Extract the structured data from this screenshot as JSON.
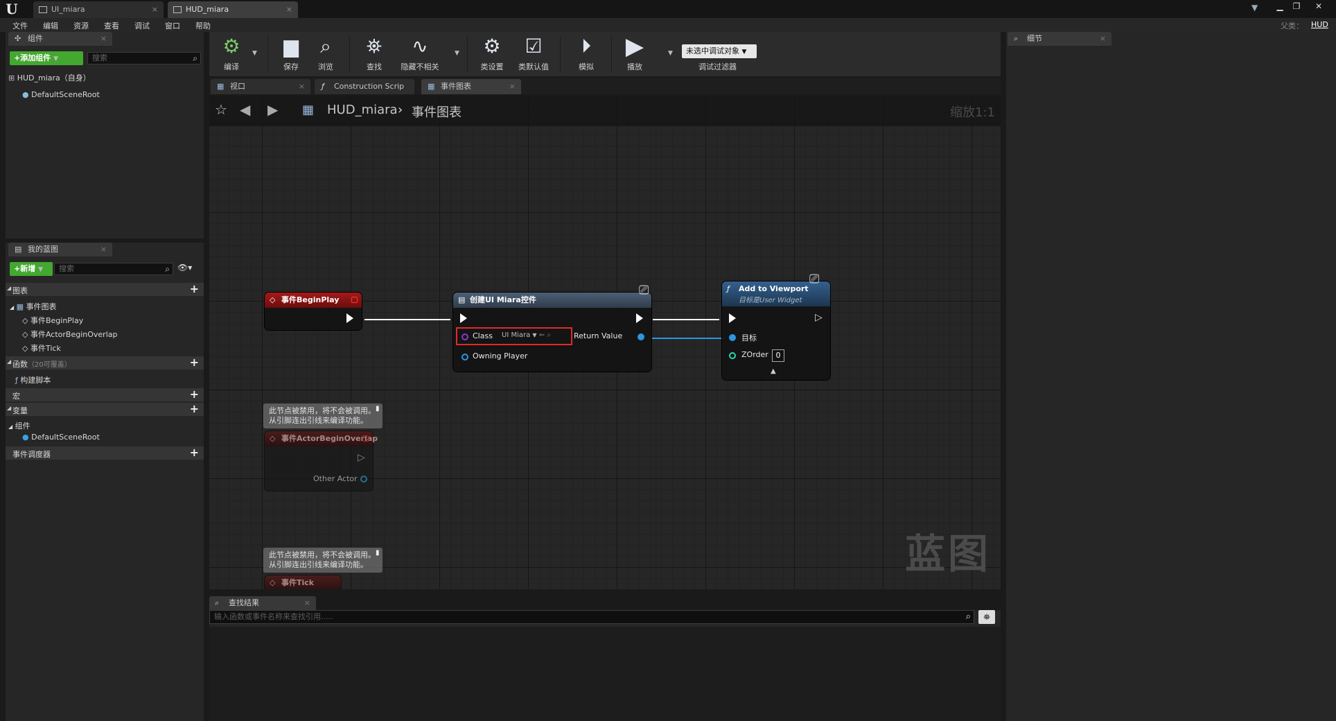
{
  "window": {
    "tabs": [
      {
        "label": "UI_miara"
      },
      {
        "label": "HUD_miara"
      }
    ],
    "parent_class_label": "父类：",
    "parent_class_value": "HUD"
  },
  "menu": [
    "文件",
    "编辑",
    "资源",
    "查看",
    "调试",
    "窗口",
    "帮助"
  ],
  "components_panel": {
    "tab": "组件",
    "add_button": "+添加组件",
    "search_placeholder": "搜索",
    "self_item": "HUD_miara（自身）",
    "root_item": "DefaultSceneRoot"
  },
  "my_blueprint_panel": {
    "tab": "我的蓝图",
    "new_button": "+新增",
    "search_placeholder": "搜索",
    "graphs_label": "图表",
    "event_graph_label": "事件图表",
    "events": [
      "事件BeginPlay",
      "事件ActorBeginOverlap",
      "事件Tick"
    ],
    "functions_label": "函数",
    "functions_override": "（20可覆盖）",
    "construction_script": "构建脚本",
    "macros_label": "宏",
    "variables_label": "变量",
    "components_label": "组件",
    "components_item": "DefaultSceneRoot",
    "event_dispatchers_label": "事件调度器"
  },
  "toolbar": {
    "compile": "编译",
    "save": "保存",
    "browse": "浏览",
    "find": "查找",
    "hide_unrelated": "隐藏不相关",
    "class_settings": "类设置",
    "class_defaults": "类默认值",
    "simulate": "模拟",
    "play": "播放",
    "debug_filter_value": "未选中调试对象",
    "debug_filter_label": "调试过滤器"
  },
  "graph_tabs": [
    {
      "label": "视口"
    },
    {
      "label": "Construction Scrip"
    },
    {
      "label": "事件图表"
    }
  ],
  "graph": {
    "breadcrumb_root": "HUD_miara",
    "breadcrumb_current": "事件图表",
    "zoom": "缩放1:1",
    "watermark": "蓝图",
    "nodes": {
      "begin_play": {
        "title": "事件BeginPlay"
      },
      "create_widget": {
        "title": "创建UI Miara控件",
        "class_label": "Class",
        "class_value": "UI Miara",
        "owning_player": "Owning Player",
        "return_value": "Return Value"
      },
      "add_to_viewport": {
        "title": "Add to Viewport",
        "subtitle": "目标是User Widget",
        "target": "目标",
        "zorder": "ZOrder",
        "zorder_value": "0"
      },
      "actor_begin_overlap": {
        "title": "事件ActorBeginOverlap",
        "other_actor": "Other Actor"
      },
      "tick": {
        "title": "事件Tick"
      }
    },
    "disabled_comment": "此节点被禁用，将不会被调用。\n从引脚连出引线来编译功能。"
  },
  "find_results": {
    "tab": "查找结果",
    "placeholder": "输入函数或事件名称来查找引用....."
  },
  "details_panel": {
    "tab": "细节"
  },
  "colors": {
    "event_head": "#8a1212",
    "function_head": "#2c4f78",
    "create_head": "#3e5064",
    "wire_exec": "#ffffff",
    "wire_object": "#2b97e0",
    "green_button": "#43a82f",
    "highlight_box": "#e02a2a"
  }
}
